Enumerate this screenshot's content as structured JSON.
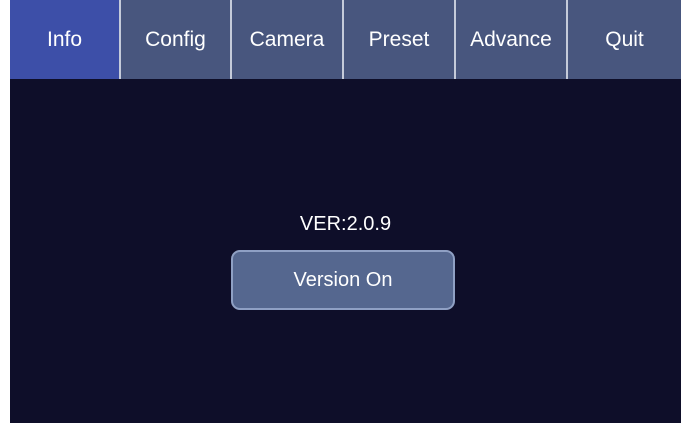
{
  "tabs": [
    {
      "label": "Info",
      "active": true
    },
    {
      "label": "Config",
      "active": false
    },
    {
      "label": "Camera",
      "active": false
    },
    {
      "label": "Preset",
      "active": false
    },
    {
      "label": "Advance",
      "active": false
    },
    {
      "label": "Quit",
      "active": false
    }
  ],
  "info": {
    "version_text": "VER:2.0.9",
    "version_button_label": "Version On"
  },
  "colors": {
    "background": "#0e0e29",
    "tab": "#48567e",
    "tab_active": "#3d4fa8",
    "button": "#55678f",
    "button_border": "#8fa0c4"
  }
}
